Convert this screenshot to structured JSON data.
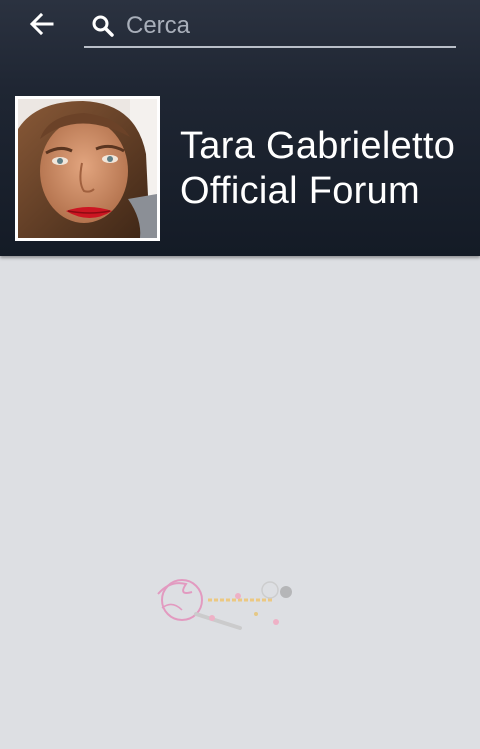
{
  "search": {
    "placeholder": "Cerca"
  },
  "profile": {
    "title_line1": "Tara Gabrieletto",
    "title_line2": "Official Forum"
  },
  "icons": {
    "back": "arrow-left-icon",
    "search": "magnifier-icon"
  },
  "colors": {
    "header": "#1a212d",
    "body": "#dddfe3",
    "text": "#ffffff"
  }
}
